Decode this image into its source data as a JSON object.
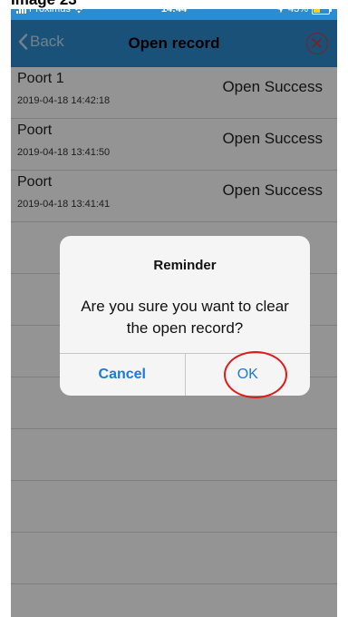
{
  "caption": {
    "text": "Image 23"
  },
  "status_bar": {
    "carrier": "Proximus",
    "time": "14:44",
    "battery_percent": "43%",
    "battery_level": 0.43
  },
  "nav": {
    "back_label": "Back",
    "title": "Open record",
    "close_icon": "close-circle-icon"
  },
  "records": [
    {
      "name": "Poort 1",
      "time": "2019-04-18 14:42:18",
      "status": "Open Success"
    },
    {
      "name": "Poort",
      "time": "2019-04-18 13:41:50",
      "status": "Open Success"
    },
    {
      "name": "Poort",
      "time": "2019-04-18 13:41:41",
      "status": "Open Success"
    }
  ],
  "dialog": {
    "title": "Reminder",
    "message": "Are you sure you want to clear the open record?",
    "cancel_label": "Cancel",
    "ok_label": "OK"
  },
  "colors": {
    "bar": "#2b8ccf",
    "accent": "#1b7ad9",
    "highlight": "#e01b1b",
    "battery": "#f8d21c"
  }
}
